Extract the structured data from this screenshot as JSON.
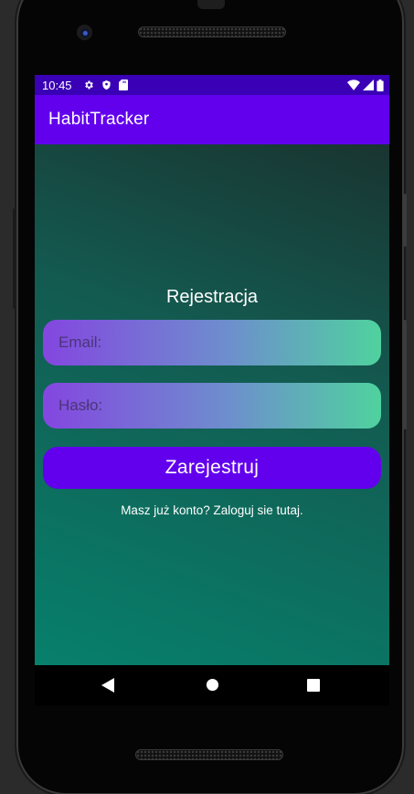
{
  "status_bar": {
    "time": "10:45",
    "left_icons": [
      "gear-icon",
      "shield-icon",
      "sd-card-icon"
    ],
    "right_icons": [
      "wifi-icon",
      "signal-icon",
      "battery-icon"
    ]
  },
  "app_bar": {
    "title": "HabitTracker"
  },
  "form": {
    "title": "Rejestracja",
    "email_placeholder": "Email:",
    "email_value": "",
    "password_placeholder": "Hasło:",
    "password_value": "",
    "submit_label": "Zarejestruj",
    "login_link": "Masz już konto? Zaloguj sie tutaj."
  },
  "nav_bar": {
    "icons": [
      "back-icon",
      "home-icon",
      "recents-icon"
    ]
  },
  "colors": {
    "primary": "#6200ee",
    "status_bar": "#3a00b5",
    "gradient_start": "#8446e0",
    "gradient_end": "#4fd29e"
  }
}
